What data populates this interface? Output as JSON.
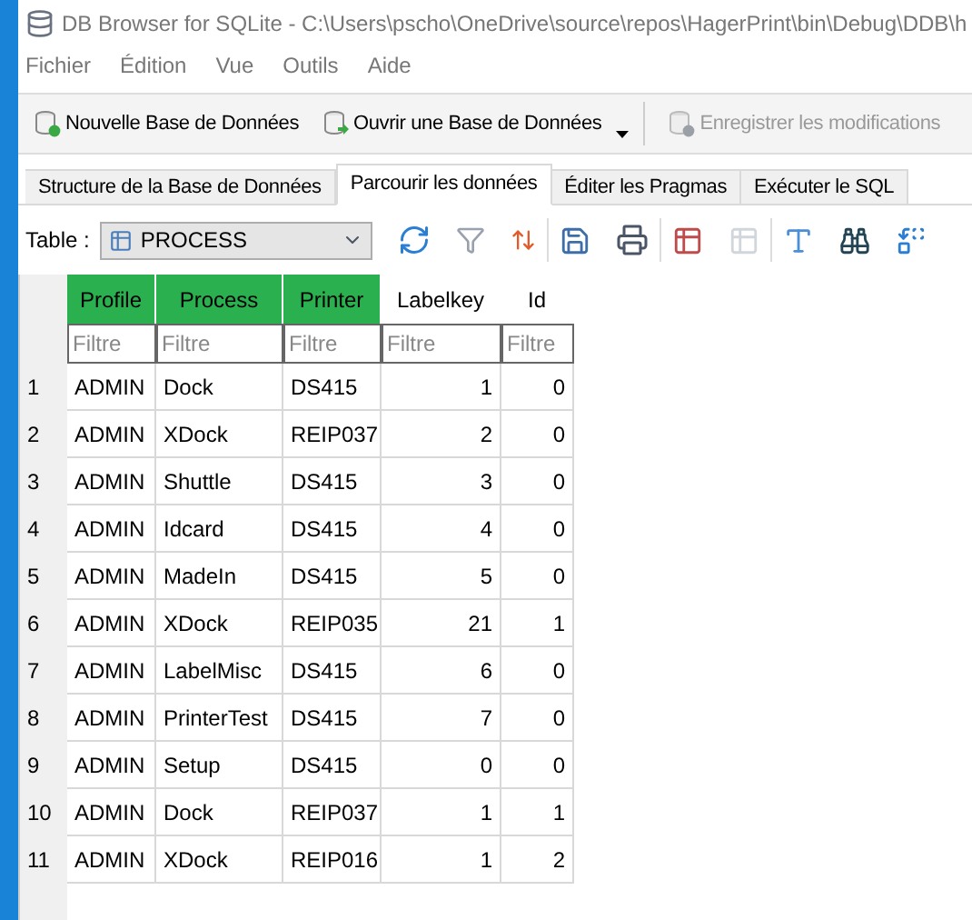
{
  "window": {
    "title": "DB Browser for SQLite - C:\\Users\\pscho\\OneDrive\\source\\repos\\HagerPrint\\bin\\Debug\\DDB\\h"
  },
  "menu": [
    "Fichier",
    "Édition",
    "Vue",
    "Outils",
    "Aide"
  ],
  "toolbar": [
    {
      "label": "Nouvelle Base de Données",
      "disabled": false,
      "kind": "new"
    },
    {
      "label": "Ouvrir une Base de Données",
      "disabled": false,
      "kind": "open"
    },
    {
      "label": "Enregistrer les modifications",
      "disabled": true,
      "kind": "save"
    }
  ],
  "tabs": [
    {
      "label": "Structure de la Base de Données",
      "selected": false
    },
    {
      "label": "Parcourir les données",
      "selected": true
    },
    {
      "label": "Éditer les Pragmas",
      "selected": false
    },
    {
      "label": "Exécuter le SQL",
      "selected": false
    }
  ],
  "table_picker": {
    "label": "Table :",
    "value": "PROCESS"
  },
  "table": {
    "columns": [
      {
        "name": "Profile",
        "highlighted": true,
        "placeholder": "Filtre"
      },
      {
        "name": "Process",
        "highlighted": true,
        "placeholder": "Filtre"
      },
      {
        "name": "Printer",
        "highlighted": true,
        "placeholder": "Filtre"
      },
      {
        "name": "Labelkey",
        "highlighted": false,
        "placeholder": "Filtre"
      },
      {
        "name": "Id",
        "highlighted": false,
        "placeholder": "Filtre"
      }
    ],
    "rows": [
      {
        "number": "1",
        "cells": [
          "ADMIN",
          "Dock",
          "DS415",
          "1",
          "0"
        ]
      },
      {
        "number": "2",
        "cells": [
          "ADMIN",
          "XDock",
          "REIP037",
          "2",
          "0"
        ]
      },
      {
        "number": "3",
        "cells": [
          "ADMIN",
          "Shuttle",
          "DS415",
          "3",
          "0"
        ]
      },
      {
        "number": "4",
        "cells": [
          "ADMIN",
          "Idcard",
          "DS415",
          "4",
          "0"
        ]
      },
      {
        "number": "5",
        "cells": [
          "ADMIN",
          "MadeIn",
          "DS415",
          "5",
          "0"
        ]
      },
      {
        "number": "6",
        "cells": [
          "ADMIN",
          "XDock",
          "REIP035",
          "21",
          "1"
        ]
      },
      {
        "number": "7",
        "cells": [
          "ADMIN",
          "LabelMisc",
          "DS415",
          "6",
          "0"
        ]
      },
      {
        "number": "8",
        "cells": [
          "ADMIN",
          "PrinterTest",
          "DS415",
          "7",
          "0"
        ]
      },
      {
        "number": "9",
        "cells": [
          "ADMIN",
          "Setup",
          "DS415",
          "0",
          "0"
        ]
      },
      {
        "number": "10",
        "cells": [
          "ADMIN",
          "Dock",
          "REIP037",
          "1",
          "1"
        ]
      },
      {
        "number": "11",
        "cells": [
          "ADMIN",
          "XDock",
          "REIP016",
          "1",
          "2"
        ]
      }
    ]
  }
}
